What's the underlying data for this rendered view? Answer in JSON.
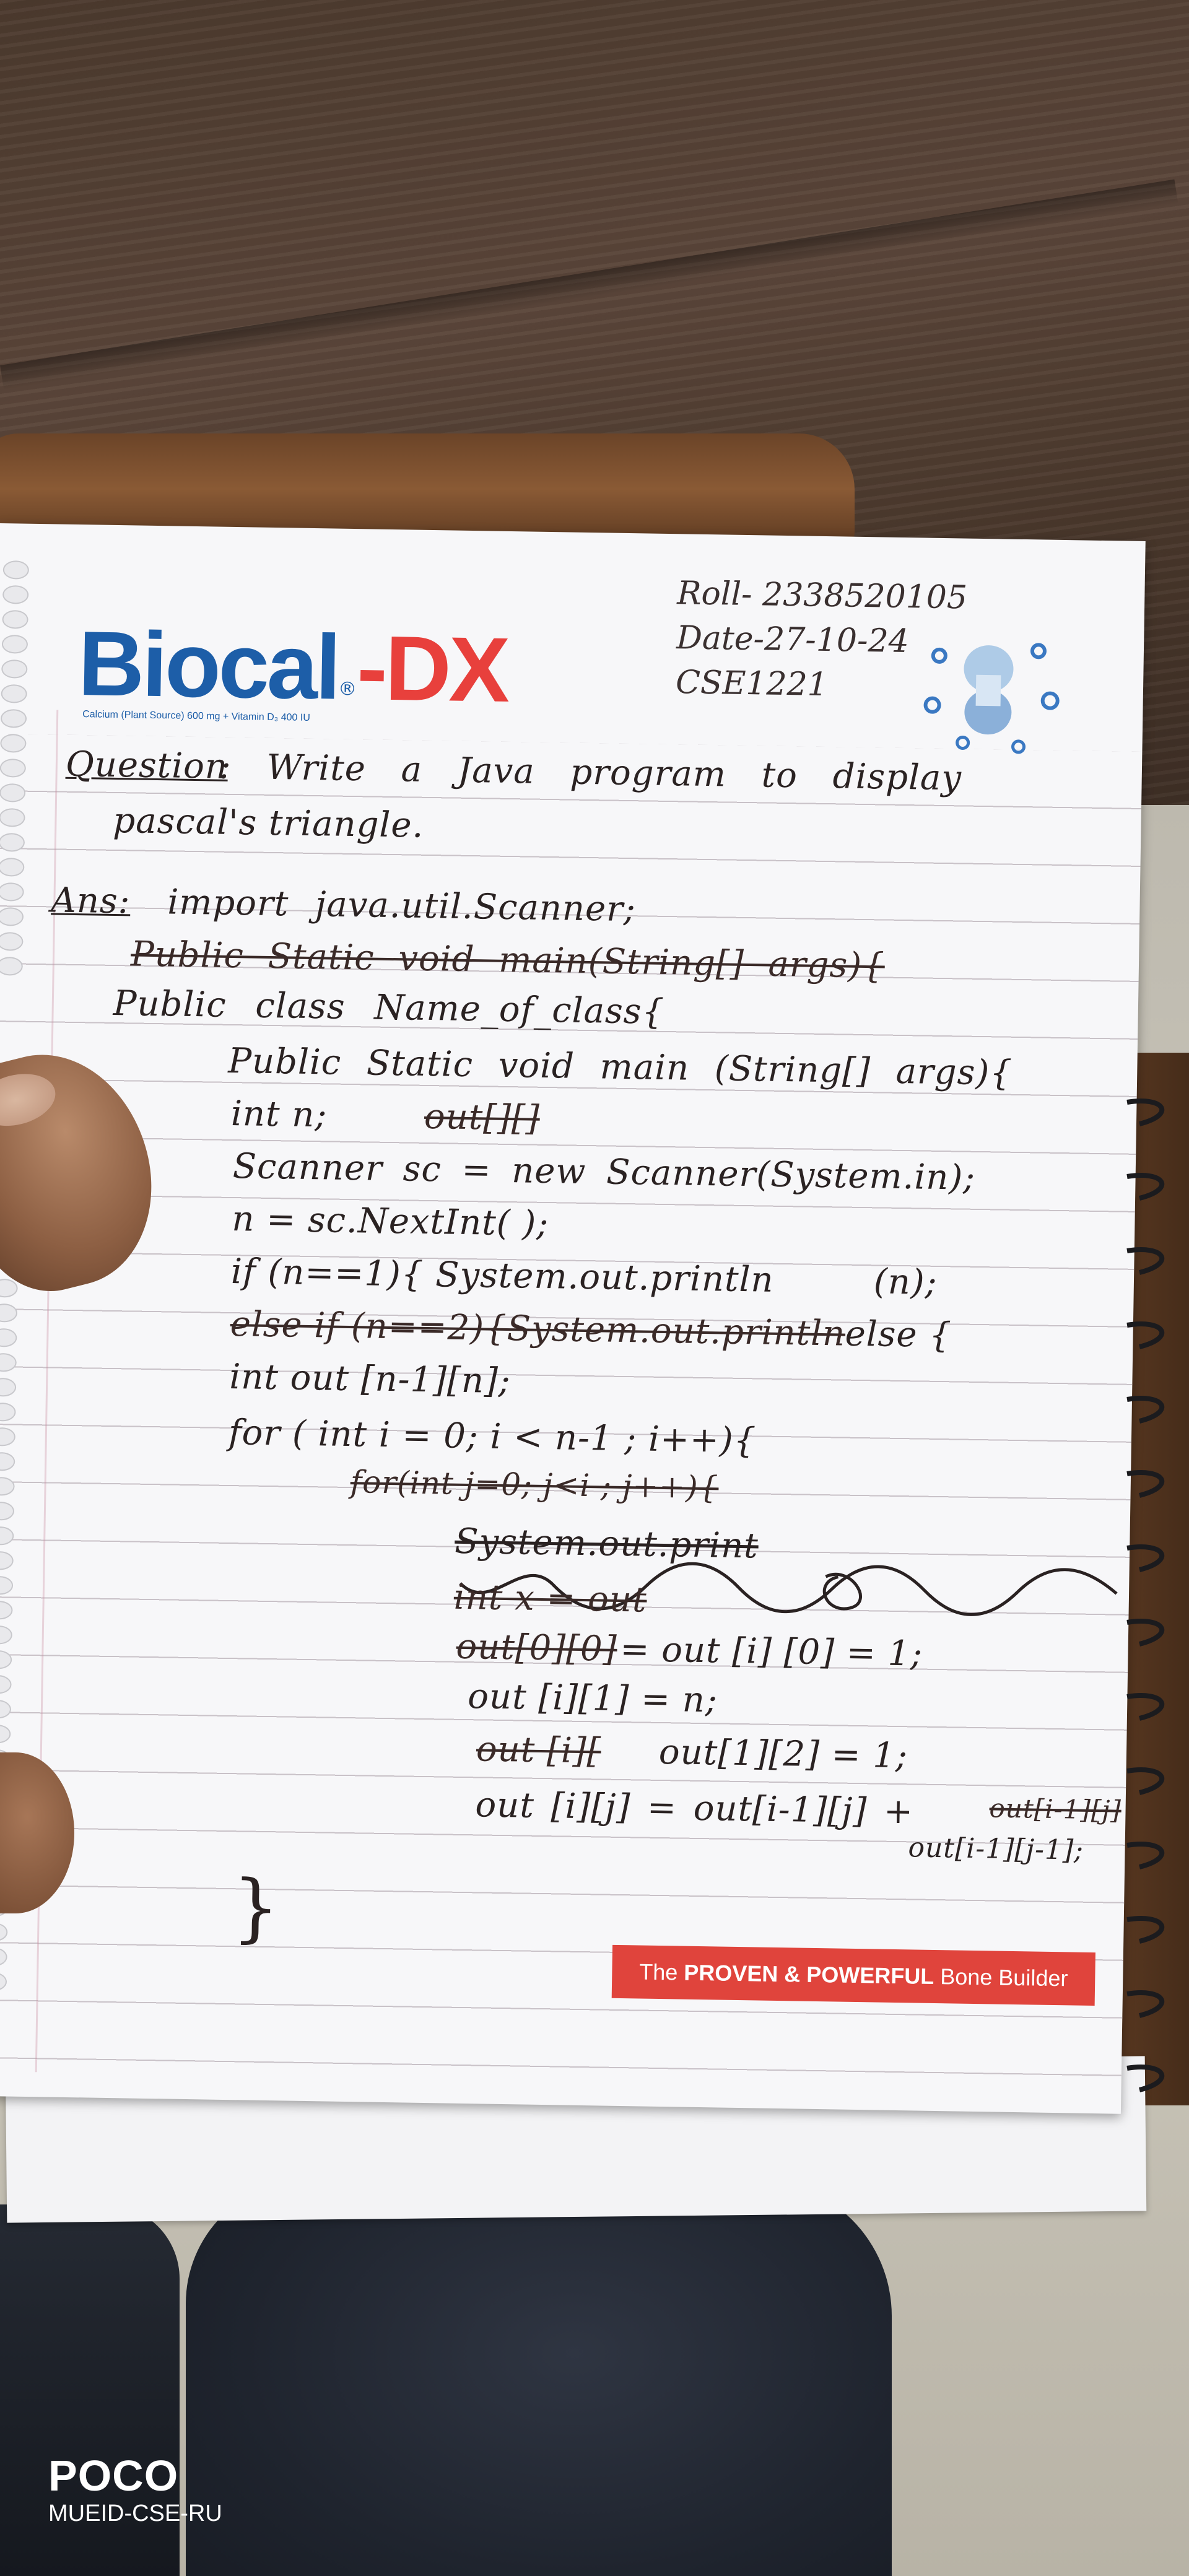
{
  "header_note": {
    "roll": "Roll- 2338520105",
    "date": "Date-27-10-24",
    "course": "CSE1221"
  },
  "logo": {
    "bio": "Biocal",
    "dx": "DX",
    "subtitle": "Calcium (Plant Source) 600 mg + Vitamin D₃ 400 IU"
  },
  "handwriting": {
    "question_label": "Question",
    "question_text": ": Write a Java program to display",
    "question_text_2": "pascal's triangle.",
    "ans_label": "Ans:",
    "line_import": "import java.util.Scanner;",
    "line_struck_main": "Public Static void main(String[] args){",
    "line_class": "Public class Name_of_class{",
    "line_main": "Public Static void main (String[] args){",
    "line_int_n": "int n;",
    "line_int_n_struck": "out[][]",
    "line_scanner": "Scanner sc = new Scanner(System.in);",
    "line_read": "n = sc.NextInt( );",
    "line_if": "if (n==1){ System.out.println",
    "line_if_end": "(n);",
    "line_else_struck": "else if (n==2){System.out.println",
    "line_else": "else {",
    "line_out_decl": "int out [n-1][n];",
    "line_for_i": "for ( int i = 0; i < n-1 ; i++){",
    "line_for_j_struck": "for(int j=0; j<i ; j++){",
    "line_sys_struck": "System.out.print",
    "line_int_x_struck": "int x = out",
    "line_out00_struck": "out[0][0]",
    "line_out_i0": "= out [i] [0] = 1;",
    "line_out_i1": "out  [i][1] = n;",
    "line_out_struck_2": "out [i][",
    "line_out_12": "out[1][2] = 1;",
    "line_out_ij": "out [i][j] = out[i-1][j] +",
    "line_out_ij_struck": "out[i-1][j]",
    "line_out_ij_2": "out[i-1][j-1];",
    "closing_brace": "}"
  },
  "banner": {
    "the": "The",
    "proven": "PROVEN",
    "amp": "&",
    "powerful": "POWERFUL",
    "bone_builder": "Bone Builder"
  },
  "watermark": {
    "brand": "POCO",
    "sub": "MUEID-CSE-RU"
  },
  "colors": {
    "logo_blue": "#1d5ea8",
    "logo_red": "#e8403c",
    "banner_red": "#e0443c",
    "ink": "#2a2222"
  }
}
